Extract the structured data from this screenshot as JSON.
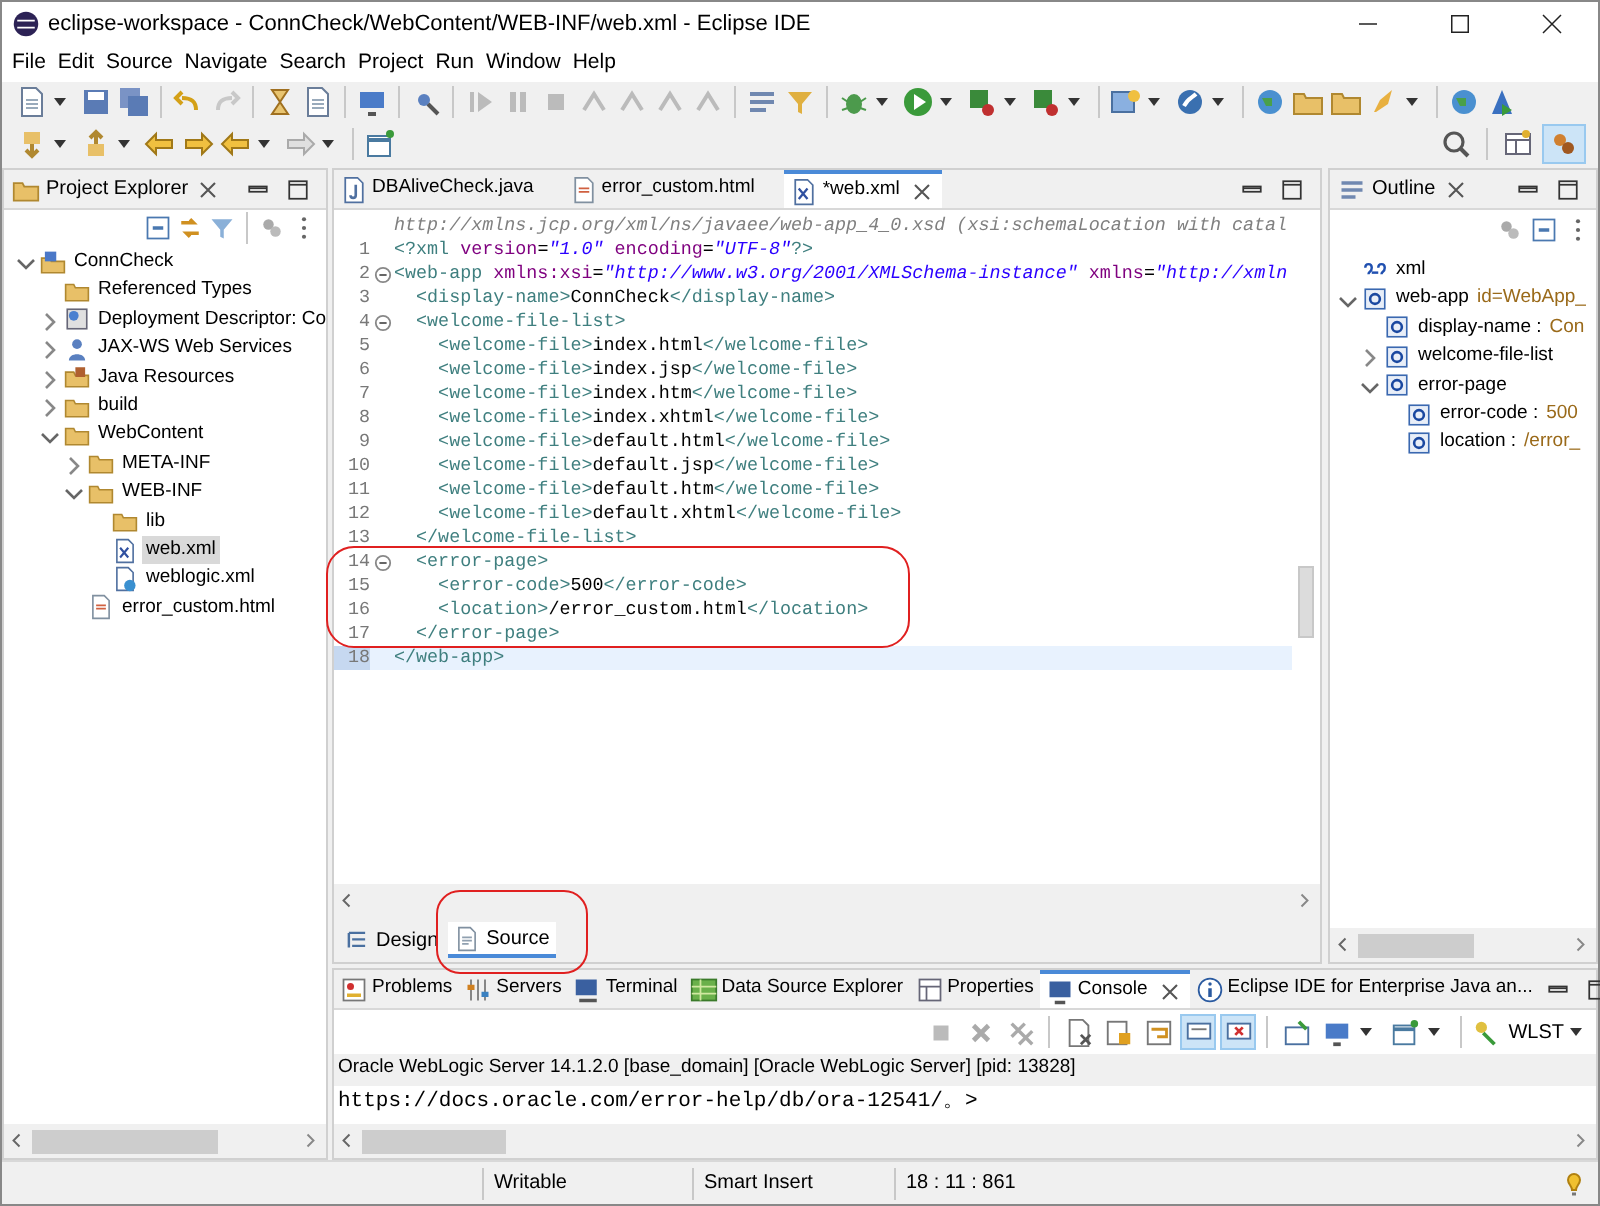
{
  "window": {
    "title": "eclipse-workspace - ConnCheck/WebContent/WEB-INF/web.xml - Eclipse IDE"
  },
  "menu": [
    "File",
    "Edit",
    "Source",
    "Navigate",
    "Search",
    "Project",
    "Run",
    "Window",
    "Help"
  ],
  "project_explorer": {
    "title": "Project Explorer",
    "tree": [
      {
        "label": "ConnCheck",
        "kind": "project",
        "expanded": true,
        "selected": false,
        "children": [
          {
            "label": "Referenced Types",
            "kind": "folder",
            "selected": false
          },
          {
            "label": "Deployment Descriptor: Co",
            "kind": "descriptor",
            "expanded": false,
            "selected": false
          },
          {
            "label": "JAX-WS Web Services",
            "kind": "webservice",
            "expanded": false,
            "selected": false
          },
          {
            "label": "Java Resources",
            "kind": "javares",
            "expanded": false,
            "selected": false
          },
          {
            "label": "build",
            "kind": "folder",
            "expanded": false,
            "selected": false
          },
          {
            "label": "WebContent",
            "kind": "folder",
            "expanded": true,
            "selected": false,
            "children": [
              {
                "label": "META-INF",
                "kind": "folder",
                "expanded": false,
                "selected": false
              },
              {
                "label": "WEB-INF",
                "kind": "folder",
                "expanded": true,
                "selected": false,
                "children": [
                  {
                    "label": "lib",
                    "kind": "folder",
                    "selected": false
                  },
                  {
                    "label": "web.xml",
                    "kind": "xml",
                    "selected": true
                  },
                  {
                    "label": "weblogic.xml",
                    "kind": "weblogic",
                    "selected": false
                  }
                ]
              },
              {
                "label": "error_custom.html",
                "kind": "html",
                "selected": false
              }
            ]
          }
        ]
      }
    ]
  },
  "editor": {
    "tabs": [
      {
        "label": "DBAliveCheck.java",
        "kind": "java",
        "selected": false
      },
      {
        "label": "error_custom.html",
        "kind": "html",
        "selected": false
      },
      {
        "label": "*web.xml",
        "kind": "xml",
        "selected": true
      }
    ],
    "header_line": "http://xmlns.jcp.org/xml/ns/javaee/web-app_4_0.xsd (xsi:schemaLocation with catal",
    "lines": [
      {
        "number": "1",
        "foldable": false,
        "current": false,
        "circled": false,
        "tokens": [
          {
            "kind": "tag",
            "text": "<?xml"
          },
          {
            "kind": "attr",
            "text": " version"
          },
          {
            "kind": "text",
            "text": "="
          },
          {
            "kind": "value",
            "text": "\"1.0\""
          },
          {
            "kind": "attr",
            "text": " encoding"
          },
          {
            "kind": "text",
            "text": "="
          },
          {
            "kind": "value",
            "text": "\"UTF-8\""
          },
          {
            "kind": "tag",
            "text": "?>"
          }
        ]
      },
      {
        "number": "2",
        "foldable": true,
        "current": false,
        "circled": false,
        "tokens": [
          {
            "kind": "tag",
            "text": "<web-app"
          },
          {
            "kind": "attr",
            "text": " xmlns:xsi"
          },
          {
            "kind": "text",
            "text": "="
          },
          {
            "kind": "value",
            "text": "\"http://www.w3.org/2001/XMLSchema-instance\""
          },
          {
            "kind": "attr",
            "text": " xmlns"
          },
          {
            "kind": "text",
            "text": "="
          },
          {
            "kind": "value",
            "text": "\"http://xmln"
          }
        ]
      },
      {
        "number": "3",
        "foldable": false,
        "current": false,
        "circled": false,
        "tokens": [
          {
            "kind": "tag",
            "text": "  <display-name>"
          },
          {
            "kind": "text",
            "text": "ConnCheck"
          },
          {
            "kind": "tag",
            "text": "</display-name>"
          }
        ]
      },
      {
        "number": "4",
        "foldable": true,
        "current": false,
        "circled": false,
        "tokens": [
          {
            "kind": "tag",
            "text": "  <welcome-file-list>"
          }
        ]
      },
      {
        "number": "5",
        "foldable": false,
        "current": false,
        "circled": false,
        "tokens": [
          {
            "kind": "tag",
            "text": "    <welcome-file>"
          },
          {
            "kind": "text",
            "text": "index.html"
          },
          {
            "kind": "tag",
            "text": "</welcome-file>"
          }
        ]
      },
      {
        "number": "6",
        "foldable": false,
        "current": false,
        "circled": false,
        "tokens": [
          {
            "kind": "tag",
            "text": "    <welcome-file>"
          },
          {
            "kind": "text",
            "text": "index.jsp"
          },
          {
            "kind": "tag",
            "text": "</welcome-file>"
          }
        ]
      },
      {
        "number": "7",
        "foldable": false,
        "current": false,
        "circled": false,
        "tokens": [
          {
            "kind": "tag",
            "text": "    <welcome-file>"
          },
          {
            "kind": "text",
            "text": "index.htm"
          },
          {
            "kind": "tag",
            "text": "</welcome-file>"
          }
        ]
      },
      {
        "number": "8",
        "foldable": false,
        "current": false,
        "circled": false,
        "tokens": [
          {
            "kind": "tag",
            "text": "    <welcome-file>"
          },
          {
            "kind": "text",
            "text": "index.xhtml"
          },
          {
            "kind": "tag",
            "text": "</welcome-file>"
          }
        ]
      },
      {
        "number": "9",
        "foldable": false,
        "current": false,
        "circled": false,
        "tokens": [
          {
            "kind": "tag",
            "text": "    <welcome-file>"
          },
          {
            "kind": "text",
            "text": "default.html"
          },
          {
            "kind": "tag",
            "text": "</welcome-file>"
          }
        ]
      },
      {
        "number": "10",
        "foldable": false,
        "current": false,
        "circled": false,
        "tokens": [
          {
            "kind": "tag",
            "text": "    <welcome-file>"
          },
          {
            "kind": "text",
            "text": "default.jsp"
          },
          {
            "kind": "tag",
            "text": "</welcome-file>"
          }
        ]
      },
      {
        "number": "11",
        "foldable": false,
        "current": false,
        "circled": false,
        "tokens": [
          {
            "kind": "tag",
            "text": "    <welcome-file>"
          },
          {
            "kind": "text",
            "text": "default.htm"
          },
          {
            "kind": "tag",
            "text": "</welcome-file>"
          }
        ]
      },
      {
        "number": "12",
        "foldable": false,
        "current": false,
        "circled": false,
        "tokens": [
          {
            "kind": "tag",
            "text": "    <welcome-file>"
          },
          {
            "kind": "text",
            "text": "default.xhtml"
          },
          {
            "kind": "tag",
            "text": "</welcome-file>"
          }
        ]
      },
      {
        "number": "13",
        "foldable": false,
        "current": false,
        "circled": false,
        "tokens": [
          {
            "kind": "tag",
            "text": "  </welcome-file-list>"
          }
        ]
      },
      {
        "number": "14",
        "foldable": true,
        "current": false,
        "circled": true,
        "tokens": [
          {
            "kind": "tag",
            "text": "  <error-page>"
          }
        ]
      },
      {
        "number": "15",
        "foldable": false,
        "current": false,
        "circled": true,
        "tokens": [
          {
            "kind": "tag",
            "text": "    <error-code>"
          },
          {
            "kind": "text",
            "text": "500"
          },
          {
            "kind": "tag",
            "text": "</error-code>"
          }
        ]
      },
      {
        "number": "16",
        "foldable": false,
        "current": false,
        "circled": true,
        "tokens": [
          {
            "kind": "tag",
            "text": "    <location>"
          },
          {
            "kind": "text",
            "text": "/error_custom.html"
          },
          {
            "kind": "tag",
            "text": "</location>"
          }
        ]
      },
      {
        "number": "17",
        "foldable": false,
        "current": false,
        "circled": true,
        "tokens": [
          {
            "kind": "tag",
            "text": "  </error-page>"
          }
        ]
      },
      {
        "number": "18",
        "foldable": false,
        "current": true,
        "circled": false,
        "tokens": [
          {
            "kind": "tag",
            "text": "</web-app>"
          }
        ]
      }
    ],
    "mode_tabs": [
      {
        "label": "Design",
        "kind": "design",
        "selected": false,
        "circled": false
      },
      {
        "label": "Source",
        "kind": "source",
        "selected": true,
        "circled": true
      }
    ]
  },
  "outline": {
    "title": "Outline",
    "tree": [
      {
        "label": "xml",
        "kind": "pi",
        "selected": false
      },
      {
        "label": "web-app",
        "value": "id=WebApp_",
        "kind": "element",
        "expanded": true,
        "selected": false,
        "children": [
          {
            "label": "display-name :",
            "value": "Con",
            "kind": "element",
            "selected": false
          },
          {
            "label": "welcome-file-list",
            "kind": "element",
            "expanded": false,
            "selected": false
          },
          {
            "label": "error-page",
            "kind": "element",
            "expanded": true,
            "selected": false,
            "children": [
              {
                "label": "error-code :",
                "value": "500",
                "kind": "element",
                "selected": false
              },
              {
                "label": "location :",
                "value": "/error_",
                "kind": "element",
                "selected": false
              }
            ]
          }
        ]
      }
    ]
  },
  "bottom_panel": {
    "tabs": [
      {
        "label": "Problems",
        "kind": "problems",
        "selected": false
      },
      {
        "label": "Servers",
        "kind": "servers",
        "selected": false
      },
      {
        "label": "Terminal",
        "kind": "terminal",
        "selected": false
      },
      {
        "label": "Data Source Explorer",
        "kind": "datasource",
        "selected": false
      },
      {
        "label": "Properties",
        "kind": "properties",
        "selected": false
      },
      {
        "label": "Console",
        "kind": "console",
        "selected": true
      },
      {
        "label": "Eclipse IDE for Enterprise Java an...",
        "kind": "info",
        "selected": false
      }
    ],
    "wlst_label": "WLST",
    "console_label": "Oracle WebLogic Server 14.1.2.0 [base_domain] [Oracle WebLogic Server]  [pid: 13828]",
    "console_output": "https://docs.oracle.com/error-help/db/ora-12541/。>"
  },
  "status_bar": [
    "Writable",
    "Smart Insert",
    "18 : 11 : 861"
  ]
}
